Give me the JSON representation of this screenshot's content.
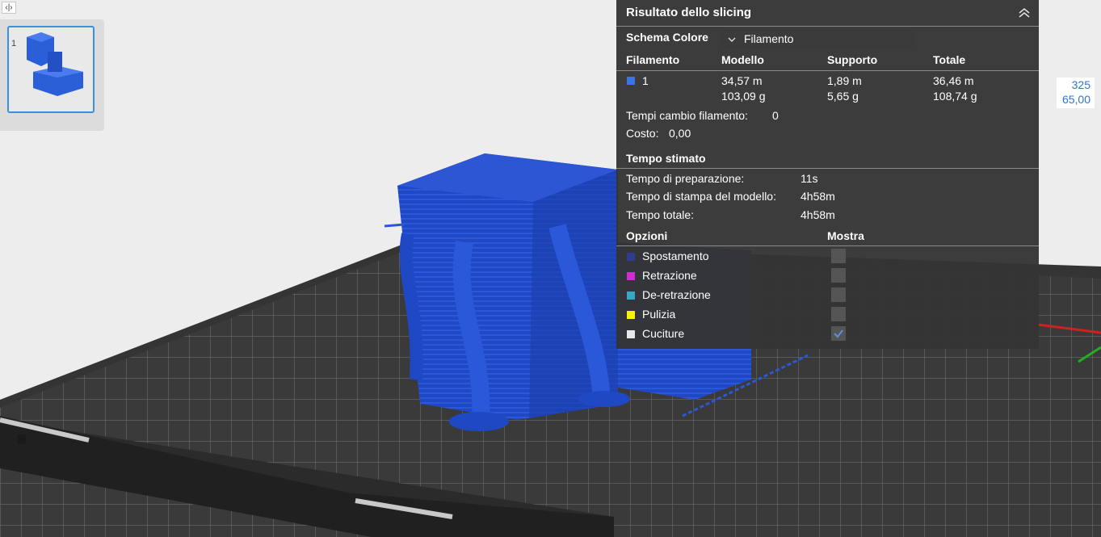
{
  "toggle": {
    "icon": "expand-collapse-icon",
    "glyph": "‹|›"
  },
  "thumbnail": {
    "label": "1"
  },
  "panel": {
    "title": "Risultato dello slicing",
    "color_scheme_label": "Schema Colore",
    "color_scheme_value": "Filamento",
    "table": {
      "headers": [
        "Filamento",
        "Modello",
        "Supporto",
        "Totale"
      ],
      "rows": [
        {
          "filament": "1",
          "color": "#3b73e8",
          "model_len": "34,57 m",
          "model_weight": "103,09 g",
          "support_len": "1,89 m",
          "support_weight": "5,65 g",
          "total_len": "36,46 m",
          "total_weight": "108,74 g"
        }
      ]
    },
    "filament_changes_label": "Tempi cambio filamento:",
    "filament_changes_value": "0",
    "cost_label": "Costo:",
    "cost_value": "0,00",
    "estimated_time_header": "Tempo stimato",
    "times": [
      {
        "label": "Tempo di preparazione:",
        "value": "11s"
      },
      {
        "label": "Tempo di stampa del modello:",
        "value": "4h58m"
      },
      {
        "label": "Tempo totale:",
        "value": "4h58m"
      }
    ],
    "options_header": "Opzioni",
    "show_header": "Mostra",
    "options": [
      {
        "label": "Spostamento",
        "color": "#2f3d8f",
        "checked": false
      },
      {
        "label": "Retrazione",
        "color": "#d42bd4",
        "checked": false
      },
      {
        "label": "De-retrazione",
        "color": "#3aa6c7",
        "checked": false
      },
      {
        "label": "Pulizia",
        "color": "#f5f20a",
        "checked": false
      },
      {
        "label": "Cuciture",
        "color": "#e8e8e8",
        "checked": true
      }
    ]
  },
  "coord": {
    "top": "325",
    "bottom": "65,00"
  }
}
